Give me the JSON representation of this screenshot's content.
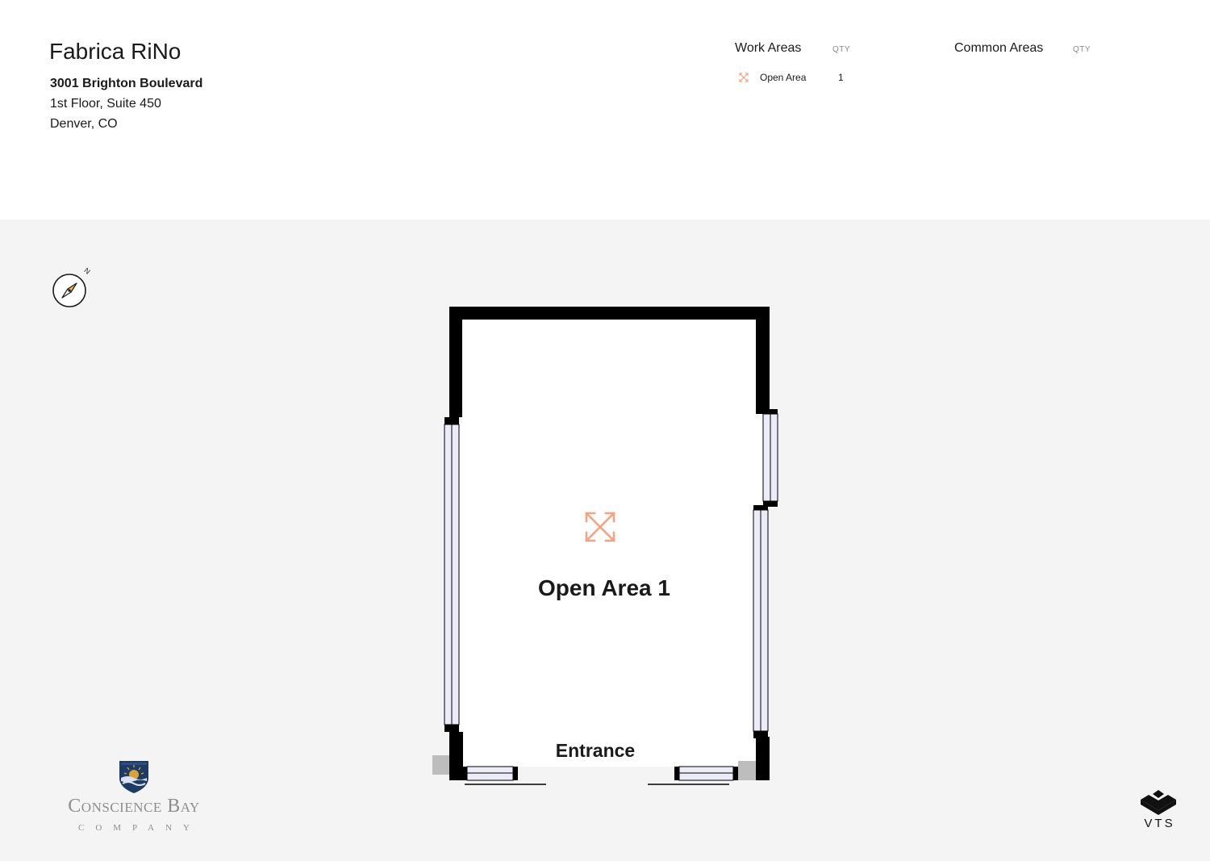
{
  "header": {
    "building_name": "Fabrica RiNo",
    "address_street": "3001 Brighton Boulevard",
    "address_floor": "1st Floor, Suite 450",
    "address_city": "Denver, CO"
  },
  "legend": {
    "work_areas": {
      "heading": "Work Areas",
      "qty_label": "QTY",
      "items": [
        {
          "label": "Open Area",
          "qty": "1",
          "icon": "expand-arrows-icon"
        }
      ]
    },
    "common_areas": {
      "heading": "Common Areas",
      "qty_label": "QTY",
      "items": []
    }
  },
  "floor_plan": {
    "room_label": "Open Area 1",
    "room_icon": "expand-arrows-icon",
    "entrance_label": "Entrance",
    "compass_north_label": "N"
  },
  "branding": {
    "left_logo_name": "Conscience Bay",
    "left_logo_sub": "COMPANY",
    "right_logo_text": "VTS"
  },
  "colors": {
    "header_bg": "#ffffff",
    "canvas_bg": "#f4f4f4",
    "wall": "#000000",
    "room_fill": "#ffffff",
    "window_fill": "#ececf8",
    "accent_icon": "#f2a585",
    "logo_gray": "#8e8e8e",
    "shield_navy": "#1d3b63",
    "shield_gold": "#d9a23a"
  }
}
